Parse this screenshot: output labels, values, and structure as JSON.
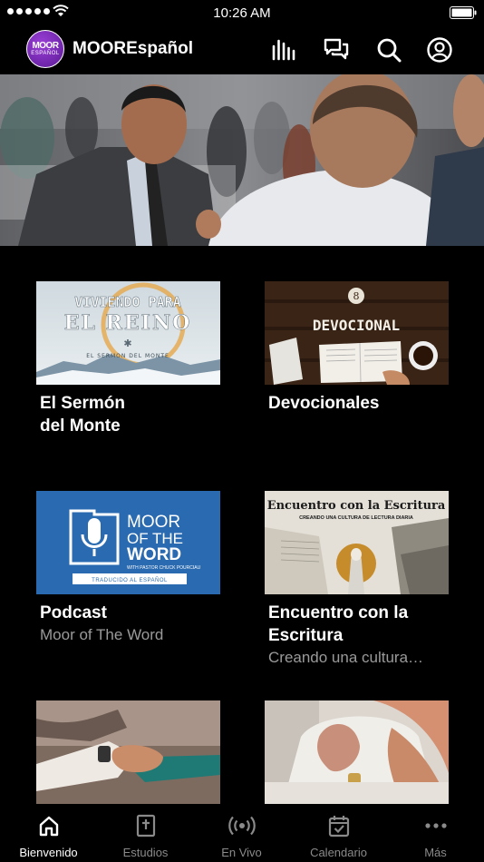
{
  "status_bar": {
    "time": "10:26 AM"
  },
  "header": {
    "logo_text_top": "MOOR",
    "logo_text_bottom": "ESPAÑOL",
    "title": "MOOREspañol"
  },
  "cards": [
    {
      "title": "El Sermón del Monte",
      "subtitle": "",
      "thumb_text": [
        "VIVIENDO PARA",
        "EL REINO",
        "EL SERMON DEL MONTE"
      ]
    },
    {
      "title": "Devocionales",
      "subtitle": "",
      "thumb_text": [
        "DEVOCIONAL"
      ]
    },
    {
      "title": "Podcast",
      "subtitle": "Moor of The Word",
      "thumb_text": [
        "MOOR",
        "OF THE",
        "WORD",
        "WITH PASTOR CHUCK POURCIAU",
        "TRADUCIDO AL ESPAÑOL"
      ]
    },
    {
      "title": "Encuentro con la Escritura",
      "subtitle": "Creando una cultura…",
      "thumb_text": [
        "Encuentro con la Escritura",
        "CREANDO UNA CULTURA DE LECTURA DIARIA"
      ]
    },
    {
      "title": "",
      "subtitle": ""
    },
    {
      "title": "",
      "subtitle": ""
    }
  ],
  "tabs": [
    {
      "label": "Bienvenido",
      "icon": "home-icon",
      "active": true
    },
    {
      "label": "Estudios",
      "icon": "bible-icon"
    },
    {
      "label": "En Vivo",
      "icon": "broadcast-icon"
    },
    {
      "label": "Calendario",
      "icon": "calendar-icon"
    },
    {
      "label": "Más",
      "icon": "more-icon"
    }
  ],
  "colors": {
    "background": "#000000",
    "accent": "#7b2fbe",
    "subtitle": "#9a9a9a",
    "podcast_blue": "#2a6ab0"
  }
}
